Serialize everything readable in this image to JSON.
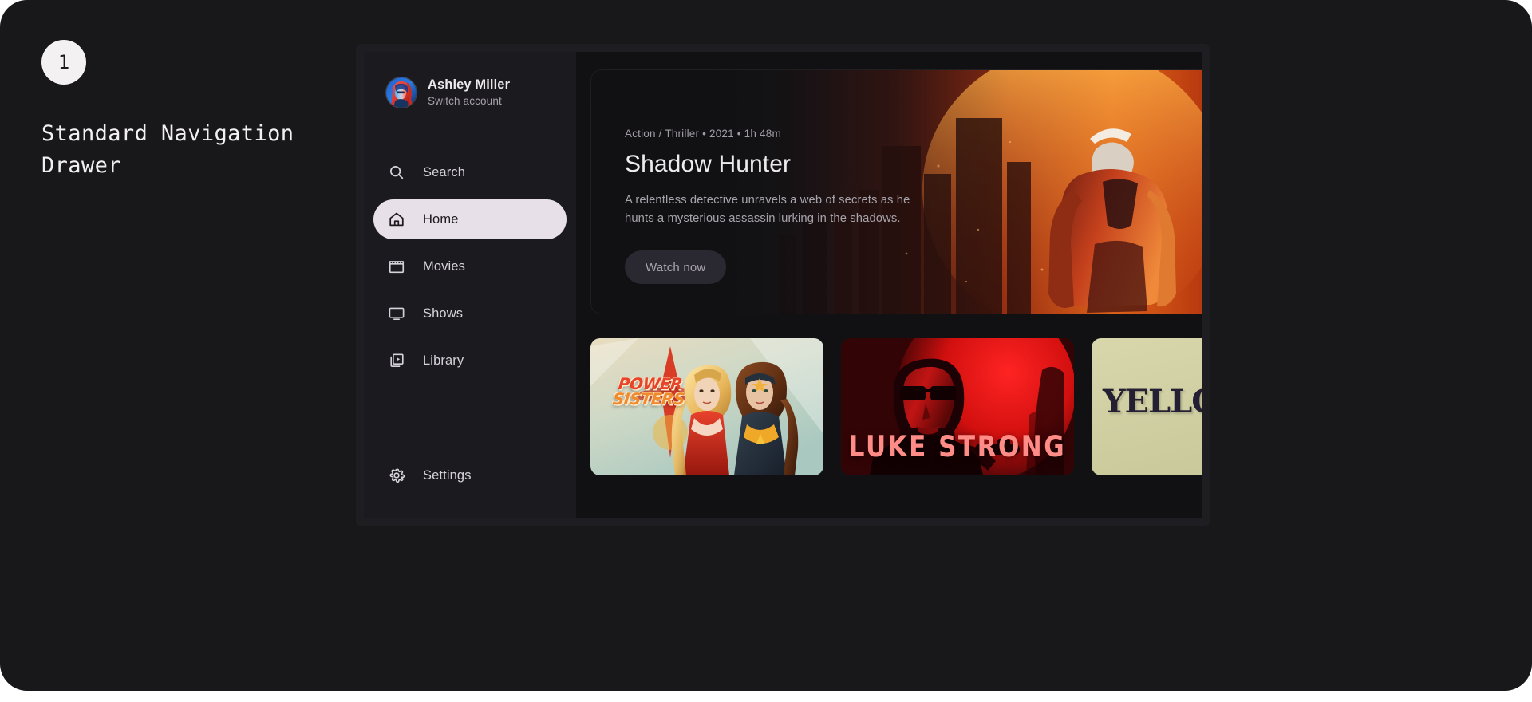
{
  "annotation": {
    "step_number": "1",
    "title": "Standard Navigation\nDrawer"
  },
  "colors": {
    "page_background": "#18181b",
    "drawer_background": "#1b1b1f",
    "content_background": "#111114",
    "active_item_background": "#e8e0e8",
    "active_item_text": "#1d1b1e",
    "nav_text": "#d6d2d9",
    "muted_text": "#a19ca6",
    "button_background": "#2a2830"
  },
  "drawer": {
    "account": {
      "name": "Ashley Miller",
      "subtitle": "Switch account",
      "avatar_icon": "user-avatar-portrait"
    },
    "items": [
      {
        "label": "Search",
        "icon": "search-icon",
        "active": false
      },
      {
        "label": "Home",
        "icon": "home-icon",
        "active": true
      },
      {
        "label": "Movies",
        "icon": "clapperboard-icon",
        "active": false
      },
      {
        "label": "Shows",
        "icon": "tv-icon",
        "active": false
      },
      {
        "label": "Library",
        "icon": "video-library-icon",
        "active": false
      }
    ],
    "footer_item": {
      "label": "Settings",
      "icon": "gear-icon",
      "active": false
    }
  },
  "hero": {
    "meta": "Action / Thriller • 2021 • 1h 48m",
    "title": "Shadow Hunter",
    "description": "A relentless detective unravels a web of secrets as he hunts a mysterious assassin lurking in the shadows.",
    "cta_label": "Watch now",
    "artwork": "muscular-hero-silhouette-orange-red-city"
  },
  "posters": [
    {
      "title_line1": "POWER",
      "title_line2": "SISTERS",
      "artwork": "two-superheroines-pastel-sky",
      "background": "#cfd9c8"
    },
    {
      "title_line1": "LUKE STRONG",
      "title_line2": "",
      "artwork": "man-with-sunglasses-red-poster",
      "background": "#e02020"
    },
    {
      "title_line1": "YELLOW",
      "title_line2": "",
      "artwork": "khaki-minimal-serif-poster",
      "background": "#d2d2a6"
    }
  ]
}
